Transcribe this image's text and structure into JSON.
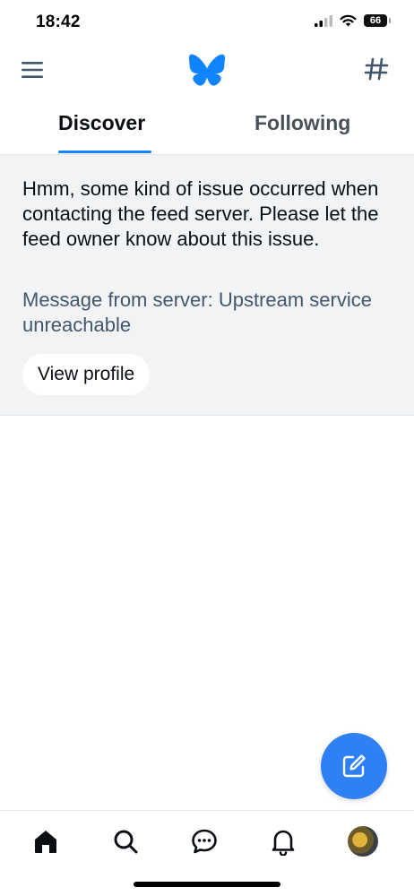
{
  "status_bar": {
    "time": "18:42",
    "battery": "66",
    "icons": [
      "signal-icon",
      "wifi-icon",
      "battery-icon"
    ]
  },
  "header": {
    "menu_icon": "menu-icon",
    "logo": "bluesky-butterfly-logo",
    "feeds_icon": "hash-icon",
    "brand_color": "#1083fe"
  },
  "tabs": [
    {
      "label": "Discover",
      "active": true
    },
    {
      "label": "Following",
      "active": false
    }
  ],
  "feed_error": {
    "message": "Hmm, some kind of issue occurred when contacting the feed server. Please let the feed owner know about this issue.",
    "server_message": "Message from server: Upstream service unreachable",
    "button_label": "View profile"
  },
  "fab": {
    "icon": "compose-icon",
    "color": "#2f80f5"
  },
  "bottom_nav": [
    {
      "name": "home",
      "icon": "home-icon",
      "active": true
    },
    {
      "name": "search",
      "icon": "search-icon",
      "active": false
    },
    {
      "name": "chat",
      "icon": "chat-icon",
      "active": false
    },
    {
      "name": "notifications",
      "icon": "bell-icon",
      "active": false
    },
    {
      "name": "profile",
      "icon": "avatar",
      "active": false
    }
  ]
}
